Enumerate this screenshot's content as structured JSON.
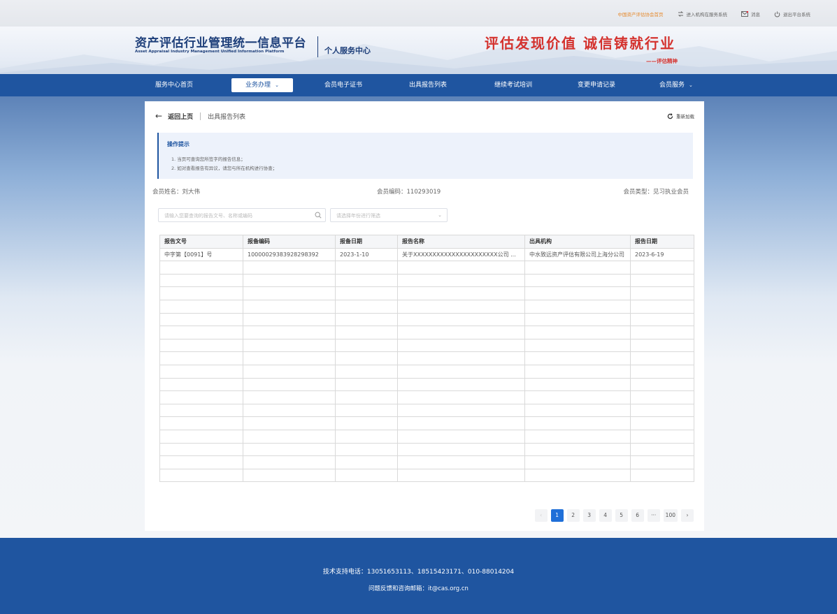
{
  "topbar": {
    "links": [
      {
        "label": "中国资产评估协会首页",
        "icon": "home-icon"
      },
      {
        "label": "进入机构在服务系统",
        "icon": "switch-icon"
      },
      {
        "label": "消息",
        "icon": "message-icon"
      },
      {
        "label": "退出平台系统",
        "icon": "power-icon"
      }
    ]
  },
  "header": {
    "logo_cn": "资产评估行业管理统一信息平台",
    "logo_en": "Asset Appraisal Industry Management Unified Information Platform",
    "subtitle": "个人服务中心",
    "slogan": "评估发现价值  诚信铸就行业",
    "slogan_sign": "——评估精神"
  },
  "nav": {
    "items": [
      {
        "label": "服务中心首页"
      },
      {
        "label": "业务办理"
      },
      {
        "label": "会员电子证书"
      },
      {
        "label": "出具报告列表"
      },
      {
        "label": "继续考试培训"
      },
      {
        "label": "变更申请记录"
      },
      {
        "label": "会员服务"
      }
    ],
    "active_index": 1
  },
  "breadcrumb": {
    "back_label": "返回上页",
    "current": "出具报告列表",
    "refresh_label": "重新加载"
  },
  "guide": {
    "title": "操作提示",
    "lines": [
      "1. 当页可查询您所签字的报告信息；",
      "2. 如对查看报告有异议，请您与所在机构进行协查；"
    ]
  },
  "member": {
    "name": "会员姓名：刘大伟",
    "number": "会员编码：110293019",
    "type": "会员类型：见习执业会员"
  },
  "filters": {
    "search_placeholder": "请输入您要查询的报告文号、名称或编码",
    "select_placeholder": "请选择年份进行筛选"
  },
  "table": {
    "columns": [
      "报告文号",
      "报备编码",
      "报备日期",
      "报告名称",
      "出具机构",
      "报告日期"
    ],
    "rows": [
      [
        "中字第【0091】号",
        "10000029383928298392",
        "2023-1-10",
        "关于XXXXXXXXXXXXXXXXXXXXXX公司 ...",
        "中水致远资产评估有限公司上海分公司",
        "2023-6-19"
      ]
    ],
    "empty_rows": 17
  },
  "pagination": {
    "prev": "‹",
    "pages": [
      "1",
      "2",
      "3",
      "4",
      "5",
      "6"
    ],
    "ellipsis": "···",
    "last": "100",
    "next": "›",
    "current": "1"
  },
  "footer": {
    "support": "技术支持电话：13051653113、18515423171、010-88014204",
    "email": "问题反馈和咨询邮箱：it@cas.org.cn"
  },
  "colors": {
    "primary": "#1f55a0",
    "accent_red": "#d4322e",
    "page_active": "#1f6fd8"
  }
}
